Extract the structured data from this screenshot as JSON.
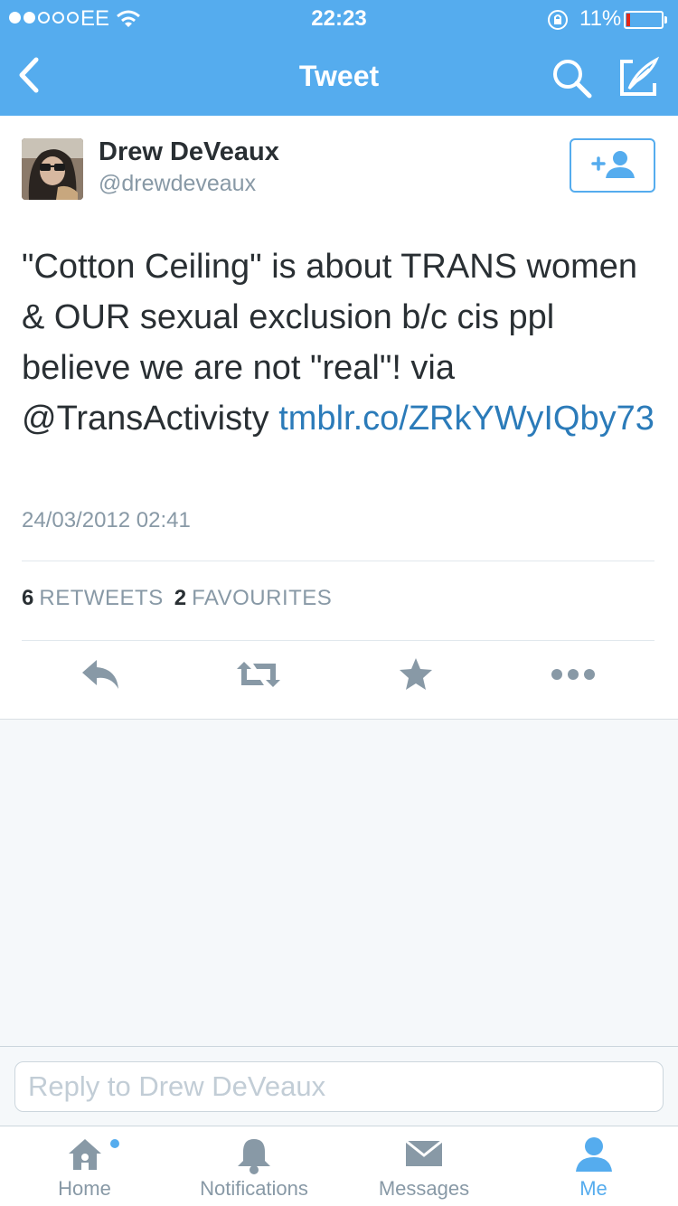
{
  "status_bar": {
    "carrier": "EE",
    "time": "22:23",
    "battery_percent": "11%",
    "battery_level": 0.11,
    "signal_bars_filled": 2,
    "signal_bars_total": 5
  },
  "nav": {
    "title": "Tweet",
    "back_icon": "chevron-left-icon",
    "search_icon": "search-icon",
    "compose_icon": "compose-icon"
  },
  "tweet": {
    "author_name": "Drew DeVeaux",
    "author_handle": "@drewdeveaux",
    "follow_icon": "add-user-icon",
    "text": "\"Cotton Ceiling\" is about TRANS women & OUR sexual exclusion b/c cis ppl believe we are not \"real\"! via @TransActivisty",
    "link": "tmblr.co/ZRkYWyIQby73",
    "timestamp": "24/03/2012 02:41",
    "retweets_count": "6",
    "retweets_label": "RETWEETS",
    "favourites_count": "2",
    "favourites_label": "FAVOURITES"
  },
  "actions": [
    "reply-icon",
    "retweet-icon",
    "star-icon",
    "more-icon"
  ],
  "reply": {
    "placeholder": "Reply to Drew DeVeaux"
  },
  "tabs": [
    {
      "label": "Home",
      "icon": "home-icon"
    },
    {
      "label": "Notifications",
      "icon": "bell-icon"
    },
    {
      "label": "Messages",
      "icon": "envelope-icon"
    },
    {
      "label": "Me",
      "icon": "person-icon",
      "active": true
    }
  ],
  "colors": {
    "brand": "#55acee",
    "link": "#2b7bb9",
    "muted": "#8899a6",
    "text": "#292f33",
    "battery_low": "#e0281b"
  }
}
